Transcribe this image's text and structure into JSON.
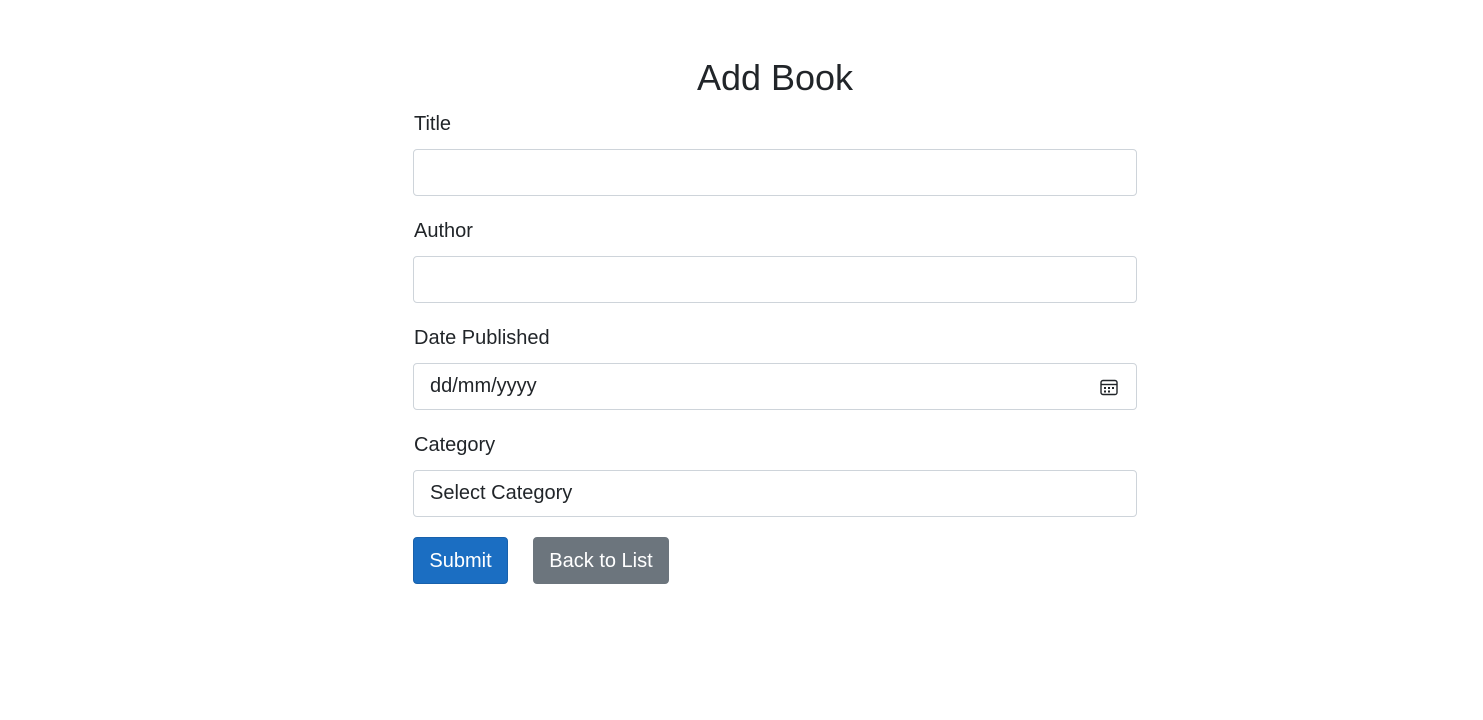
{
  "page": {
    "title": "Add Book"
  },
  "form": {
    "title_field": {
      "label": "Title",
      "value": ""
    },
    "author_field": {
      "label": "Author",
      "value": ""
    },
    "date_field": {
      "label": "Date Published",
      "placeholder": "dd/mm/yyyy",
      "icon": "calendar-icon"
    },
    "category_field": {
      "label": "Category",
      "selected": "Select Category"
    }
  },
  "actions": {
    "submit_label": "Submit",
    "back_label": "Back to List"
  },
  "colors": {
    "primary": "#1b6ec2",
    "secondary": "#6c757d",
    "border": "#ced4da"
  }
}
